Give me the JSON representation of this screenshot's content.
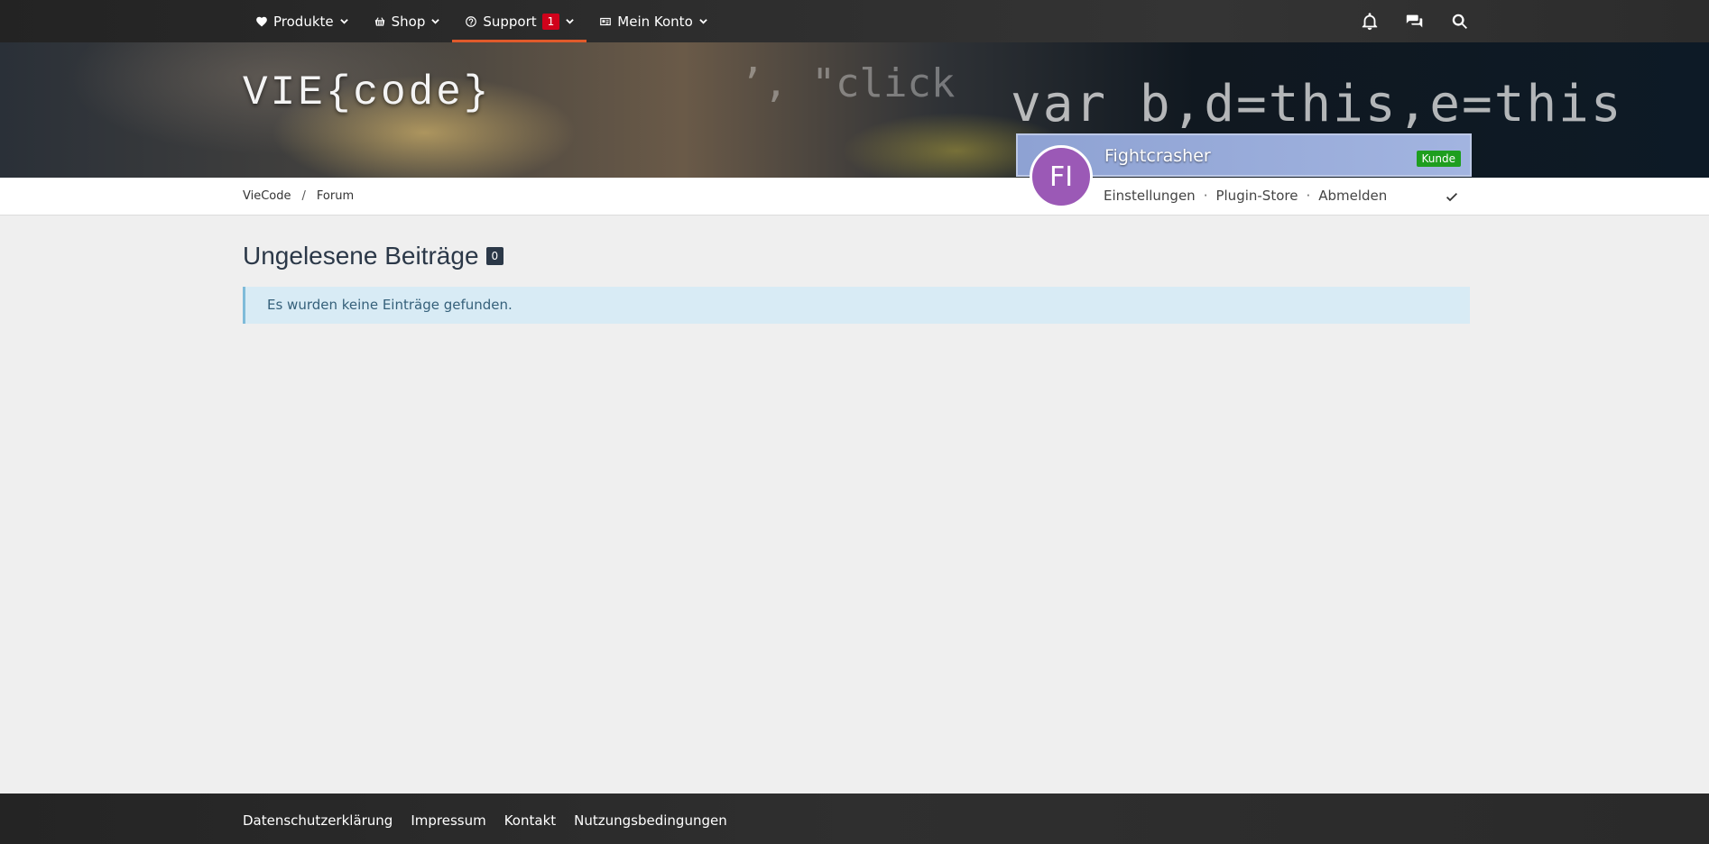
{
  "nav": {
    "items": [
      {
        "label": "Produkte",
        "icon": "heart-icon"
      },
      {
        "label": "Shop",
        "icon": "basket-icon"
      },
      {
        "label": "Support",
        "icon": "question-circle-icon",
        "badge": "1"
      },
      {
        "label": "Mein Konto",
        "icon": "id-card-icon"
      }
    ],
    "right_icons": [
      "bell-icon",
      "comments-icon",
      "search-icon"
    ]
  },
  "header": {
    "logo": "VIE{code}",
    "banner_code_1": "var b,d=this,e=this",
    "banner_code_2": "’, \"click"
  },
  "breadcrumb": [
    "VieCode",
    "Forum"
  ],
  "user": {
    "initials": "FI",
    "name": "Fightcrasher",
    "badge": "Kunde",
    "links": [
      "Einstellungen",
      "Plugin-Store",
      "Abmelden"
    ]
  },
  "main": {
    "title": "Ungelesene Beiträge",
    "count": "0",
    "notice": "Es wurden keine Einträge gefunden."
  },
  "footer": {
    "links": [
      "Datenschutzerklärung",
      "Impressum",
      "Kontakt",
      "Nutzungsbedingungen"
    ]
  },
  "colors": {
    "accent": "#e05a2b",
    "badge_red": "#d0021b",
    "kunde_green": "#1e9e1e",
    "avatar_purple": "#9b59b6"
  }
}
